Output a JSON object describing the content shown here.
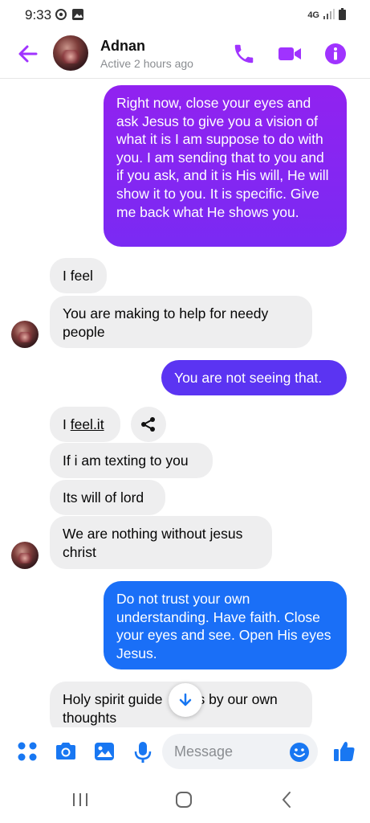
{
  "status_bar": {
    "time": "9:33",
    "network": "4G",
    "icons": [
      "sync-icon",
      "gallery-notification-icon",
      "signal-icon",
      "battery-icon"
    ]
  },
  "header": {
    "name": "Adnan",
    "status": "Active 2 hours ago",
    "icons": [
      "back-arrow-icon",
      "phone-icon",
      "video-icon",
      "info-icon"
    ]
  },
  "messages": [
    {
      "from": "me",
      "text": "Right now, close your eyes and ask Jesus to give you a vision of what it is I am suppose to do with you.  I am sending that to you and if you ask, and it is His will, He will show it to you.  It is specific.  Give me back what He shows you."
    },
    {
      "from": "them",
      "text": "I feel"
    },
    {
      "from": "them",
      "text": "You are making to help for needy people"
    },
    {
      "from": "me",
      "text": "You are not seeing that."
    },
    {
      "from": "them",
      "text_prefix": "I ",
      "link": "feel.it"
    },
    {
      "from": "them",
      "text": "If i am texting to you"
    },
    {
      "from": "them",
      "text": "Its will of lord"
    },
    {
      "from": "them",
      "text": "We are nothing without jesus christ"
    },
    {
      "from": "me",
      "text": "Do not trust your own understanding.  Have faith.  Close your eyes and see.  Open His eyes Jesus."
    },
    {
      "from": "them",
      "text_line1_start": "Holy spirit guide",
      "text_line1_end": "s by our own",
      "text_line2": "thoughts"
    }
  ],
  "composer": {
    "placeholder": "Message",
    "icons": [
      "apps-icon",
      "camera-icon",
      "gallery-icon",
      "microphone-icon",
      "emoji-icon",
      "thumbs-up-icon"
    ]
  },
  "colors": {
    "accent": "#a033ff",
    "outgoing_top": "#8a1ff0",
    "outgoing_mid": "#6a2cf5",
    "outgoing_bottom": "#1a73f8",
    "incoming_bg": "#eeeeef",
    "blue_icon": "#1877f2"
  }
}
